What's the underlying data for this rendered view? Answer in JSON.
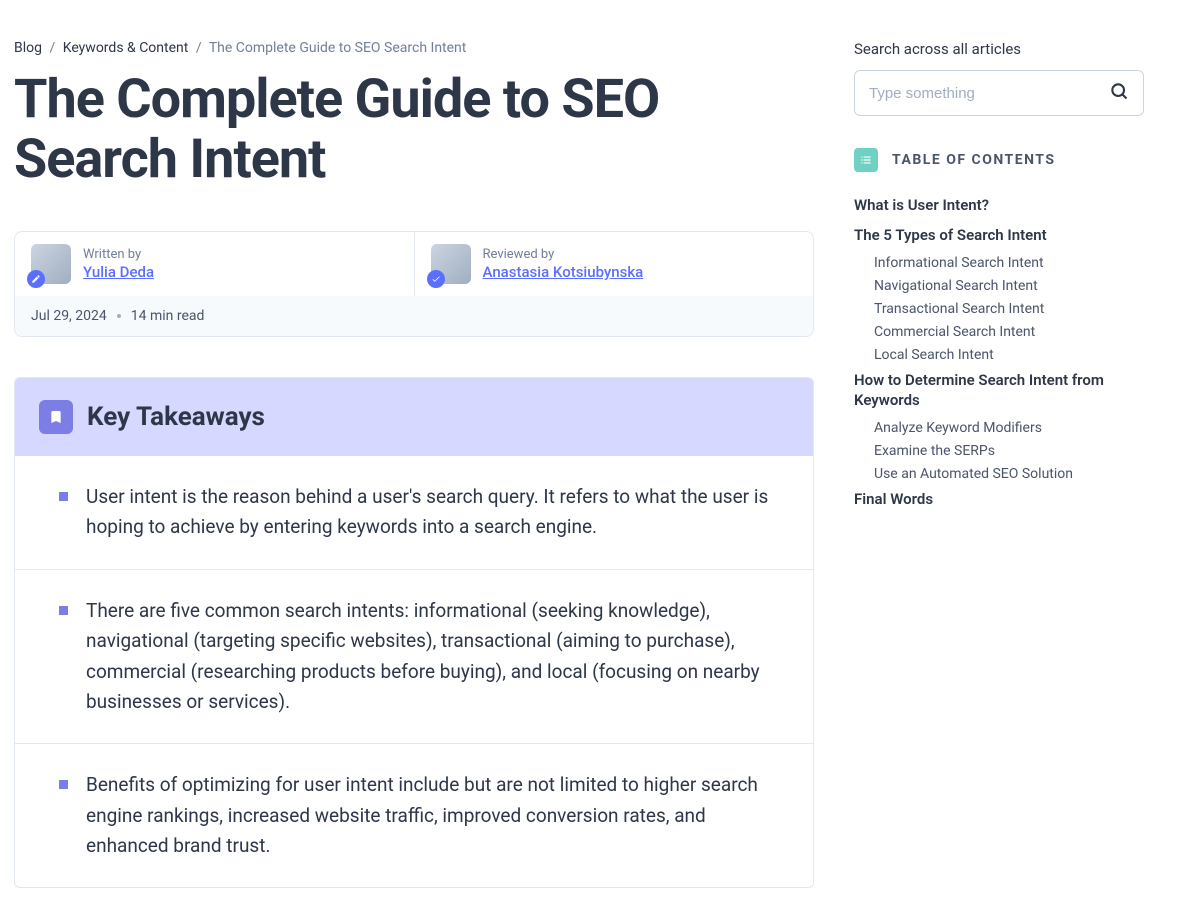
{
  "breadcrumb": {
    "blog": "Blog",
    "category": "Keywords & Content",
    "current": "The Complete Guide to SEO Search Intent"
  },
  "title": "The Complete Guide to SEO Search Intent",
  "author": {
    "written_label": "Written by",
    "written_name": "Yulia Deda",
    "reviewed_label": "Reviewed by",
    "reviewed_name": "Anastasia Kotsiubynska"
  },
  "meta": {
    "date": "Jul 29, 2024",
    "read_time": "14 min read"
  },
  "takeaways": {
    "heading": "Key Takeaways",
    "items": [
      "User intent is the reason behind a user's search query. It refers to what the user is hoping to achieve by entering keywords into a search engine.",
      "There are five common search intents: informational (seeking knowledge), navigational (targeting specific websites), transactional (aiming to purchase), commercial (researching products before buying), and local (focusing on nearby businesses or services).",
      "Benefits of optimizing for user intent include but are not limited to higher search engine rankings, increased website traffic, improved conversion rates, and enhanced brand trust."
    ]
  },
  "sidebar": {
    "search_label": "Search across all articles",
    "search_placeholder": "Type something",
    "toc_heading": "TABLE OF CONTENTS",
    "toc": [
      {
        "label": "What is User Intent?",
        "children": []
      },
      {
        "label": "The 5 Types of Search Intent",
        "children": [
          "Informational Search Intent",
          "Navigational Search Intent",
          "Transactional Search Intent",
          "Commercial Search Intent",
          "Local Search Intent"
        ]
      },
      {
        "label": "How to Determine Search Intent from Keywords",
        "children": [
          "Analyze Keyword Modifiers",
          "Examine the SERPs",
          "Use an Automated SEO Solution"
        ]
      },
      {
        "label": "Final Words",
        "children": []
      }
    ]
  }
}
